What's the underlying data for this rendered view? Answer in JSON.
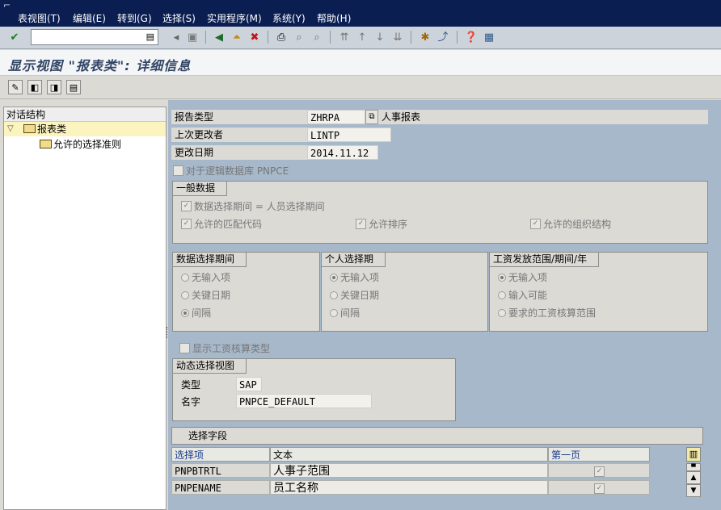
{
  "menu": {
    "items": [
      "表视图(T)",
      "编辑(E)",
      "转到(G)",
      "选择(S)",
      "实用程序(M)",
      "系统(Y)",
      "帮助(H)"
    ]
  },
  "title": "显示视图 \"报表类\": 详细信息",
  "tree": {
    "header": "对话结构",
    "node1": "报表类",
    "node2": "允许的选择准则"
  },
  "header_fields": {
    "report_type_label": "报告类型",
    "report_type_value": "ZHRPA",
    "report_type_desc": "人事报表",
    "changed_by_label": "上次更改者",
    "changed_by_value": "LINTP",
    "changed_on_label": "更改日期",
    "changed_on_value": "2014.11.12"
  },
  "logical_db_checkbox": "对于逻辑数据库 PNPCE",
  "general": {
    "title": "一般数据",
    "data_period": "数据选择期间 = 人员选择期间",
    "match_codes": "允许的匹配代码",
    "sorting": "允许排序",
    "org_structure": "允许的组织结构"
  },
  "data_sel_period": {
    "title": "数据选择期间",
    "opt1": "无输入项",
    "opt2": "关键日期",
    "opt3": "间隔",
    "selected": "间隔"
  },
  "person_sel_period": {
    "title": "个人选择期",
    "opt1": "无输入项",
    "opt2": "关键日期",
    "opt3": "间隔",
    "selected": "无输入项"
  },
  "payroll_area": {
    "title": "工资发放范围/期间/年",
    "opt1": "无输入项",
    "opt2": "输入可能",
    "opt3": "要求的工资核算范围",
    "selected": "无输入项"
  },
  "show_payroll_type": "显示工资核算类型",
  "dynamic_view": {
    "title": "动态选择视图",
    "type_label": "类型",
    "type_value": "SAP",
    "name_label": "名字",
    "name_value": "PNPCE_DEFAULT"
  },
  "sel_fields": {
    "title": "选择字段",
    "columns": [
      "选择项",
      "文本",
      "第一页"
    ],
    "rows": [
      {
        "field": "PNPBTRTL",
        "text": "人事子范围",
        "first_page": true
      },
      {
        "field": "PNPENAME",
        "text": "员工名称",
        "first_page": true
      }
    ]
  },
  "colors": {
    "menubar_bg": "#0a1e52",
    "pane_bg": "#a6b8c9",
    "title_text": "#314566"
  }
}
